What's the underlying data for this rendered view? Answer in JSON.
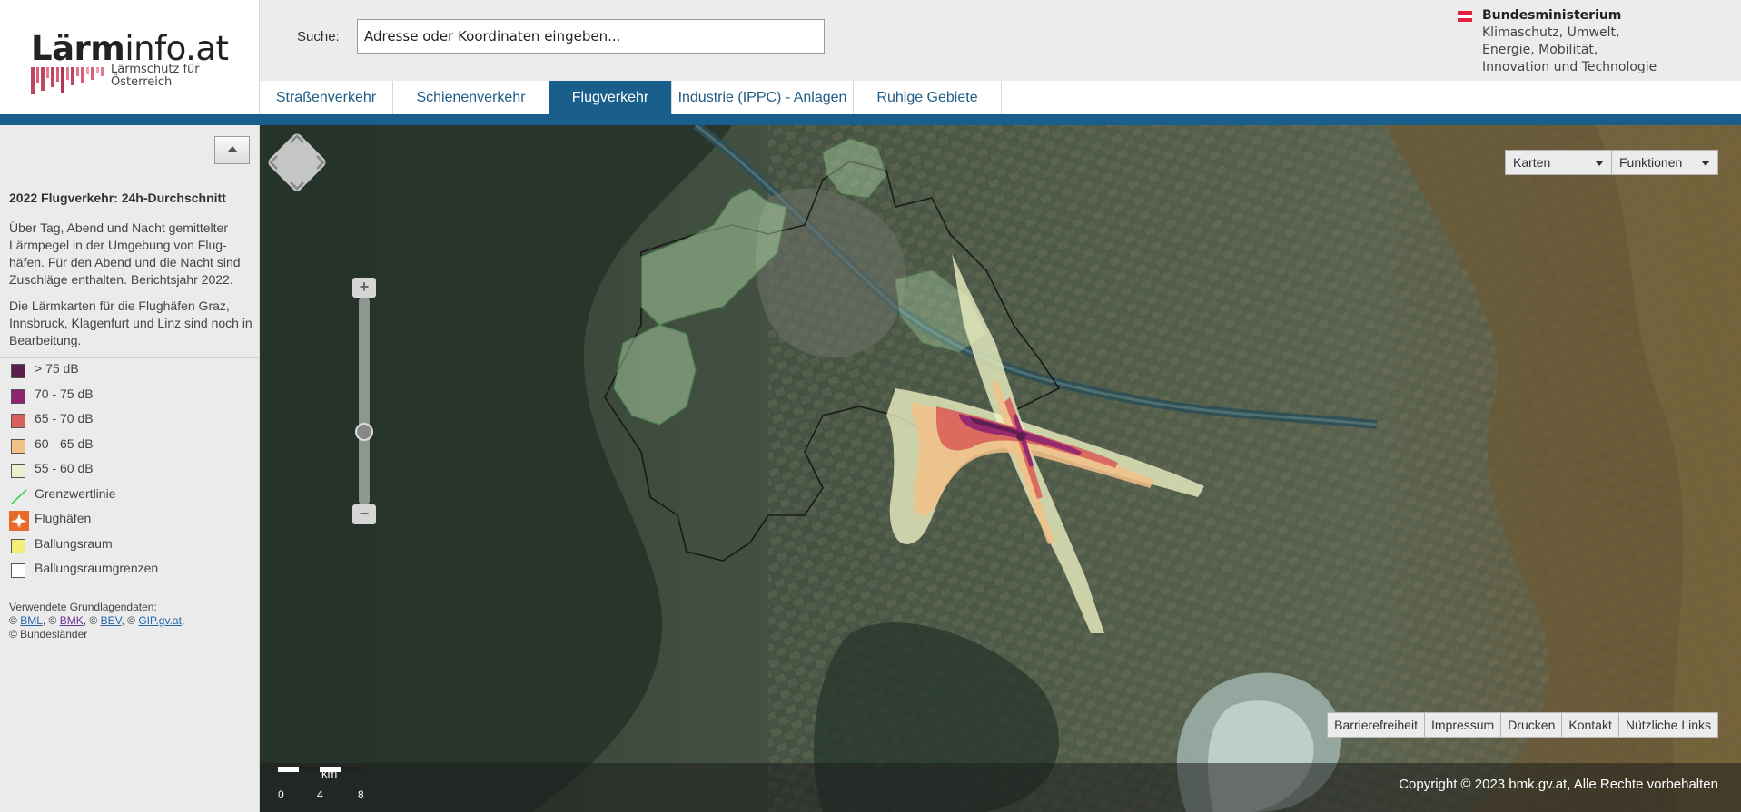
{
  "header": {
    "logo_main_bold": "Lärm",
    "logo_main_rest": "info.at",
    "logo_sub": "Lärmschutz für Österreich",
    "search_label": "Suche:",
    "search_value": "Adresse oder Koordinaten eingeben...",
    "ministry_name": "Bundesministerium",
    "ministry_lines": [
      "Klimaschutz, Umwelt,",
      "Energie, Mobilität,",
      "Innovation und Technologie"
    ]
  },
  "tabs": [
    {
      "label": "Straßenverkehr",
      "active": false
    },
    {
      "label": "Schienenverkehr",
      "active": false
    },
    {
      "label": "Flugverkehr",
      "active": true
    },
    {
      "label": "Industrie (IPPC) - Anlagen",
      "active": false
    },
    {
      "label": "Ruhige Gebiete",
      "active": false
    }
  ],
  "sidebar": {
    "title": "2022 Flugverkehr: 24h-Durchschnitt",
    "paragraph1": "Über Tag, Abend und Nacht gemittelter Lärmpegel in der Umgebung von Flug-häfen. Für den Abend und die Nacht sind Zuschläge enthalten. Berichtsjahr 2022.",
    "paragraph2": "Die Lärmkarten für die Flughäfen Graz, Innsbruck, Klagenfurt und Linz sind noch in Bearbeitung.",
    "legend": [
      {
        "label": "> 75 dB",
        "color": "#5b1f4e",
        "type": "box"
      },
      {
        "label": "70 - 75 dB",
        "color": "#8d2470",
        "type": "box"
      },
      {
        "label": "65 - 70 dB",
        "color": "#d9605a",
        "type": "box"
      },
      {
        "label": "60 - 65 dB",
        "color": "#f2c188",
        "type": "box"
      },
      {
        "label": "55 - 60 dB",
        "color": "#e9f1cf",
        "type": "box"
      },
      {
        "label": "Grenzwertlinie",
        "color": "#3bd45a",
        "type": "line"
      },
      {
        "label": "Flughäfen",
        "color": "#e8692a",
        "type": "airport"
      },
      {
        "label": "Ballungsraum",
        "color": "#f2ee78",
        "type": "box"
      },
      {
        "label": "Ballungsraumgrenzen",
        "color": "#ffffff",
        "type": "box"
      }
    ],
    "credits_prefix": "Verwendete Grundlagendaten:",
    "credits": [
      "BML",
      "BMK",
      "BEV",
      "GIP.gv.at"
    ],
    "credits_suffix": "© Bundesländer"
  },
  "map": {
    "dropdowns": [
      "Karten",
      "Funktionen"
    ],
    "footer_links": [
      "Barrierefreiheit",
      "Impressum",
      "Drucken",
      "Kontakt",
      "Nützliche Links"
    ],
    "copyright": "Copyright © 2023 bmk.gv.at, Alle Rechte vorbehalten",
    "scale_unit": "km",
    "scale_ticks": [
      "0",
      "4",
      "8"
    ]
  }
}
